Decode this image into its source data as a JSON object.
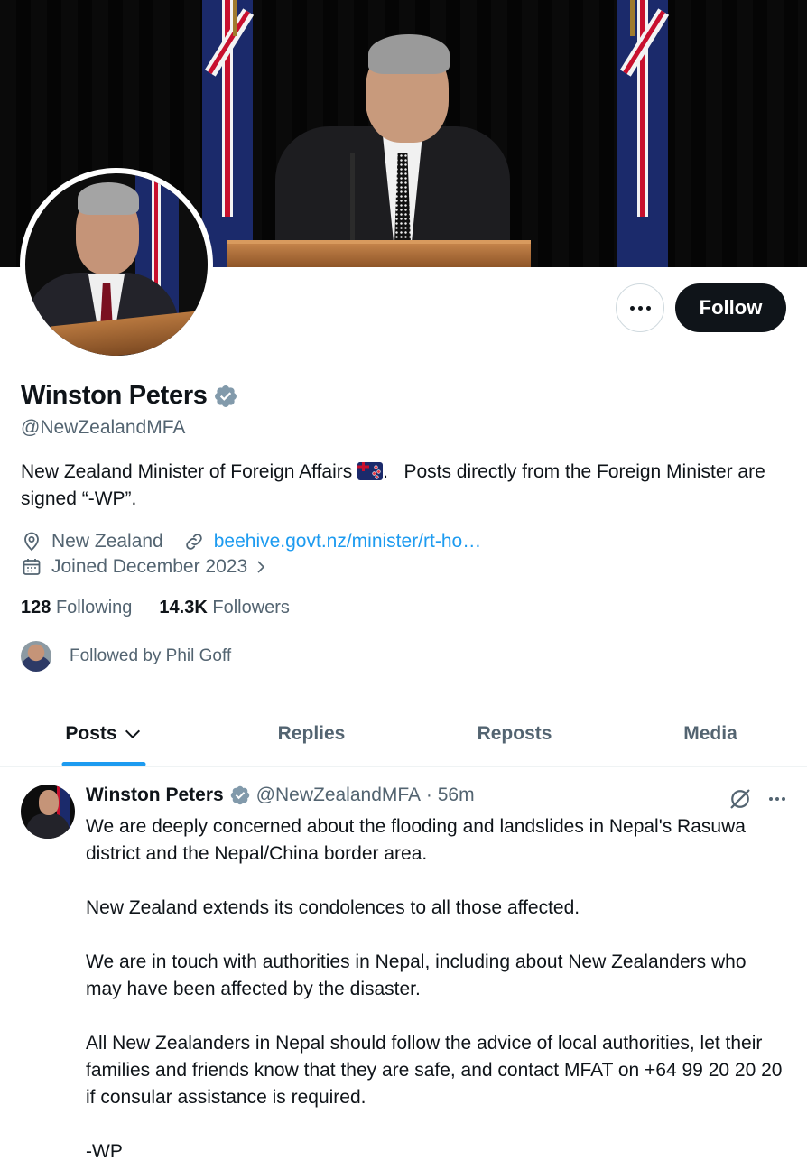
{
  "profile": {
    "name": "Winston Peters",
    "handle": "@NewZealandMFA",
    "bio_part1": "New Zealand Minister of Foreign Affairs ",
    "bio_flag": "nz-flag-emoji",
    "bio_part2": ".   Posts directly from the Foreign Minister are signed “-WP”.",
    "location": "New Zealand",
    "website": "beehive.govt.nz/minister/rt-ho…",
    "joined": "Joined December 2023",
    "following_count": "128",
    "following_label": "Following",
    "followers_count": "14.3K",
    "followers_label": "Followers",
    "followed_by": "Followed by Phil Goff"
  },
  "actions": {
    "follow_label": "Follow",
    "more_icon": "more-horizontal-icon"
  },
  "tabs": [
    {
      "label": "Posts",
      "active": true
    },
    {
      "label": "Replies",
      "active": false
    },
    {
      "label": "Reposts",
      "active": false
    },
    {
      "label": "Media",
      "active": false
    }
  ],
  "tweet": {
    "author_name": "Winston Peters",
    "author_handle": "@NewZealandMFA",
    "separator": " · ",
    "time": "56m",
    "text": "We are deeply concerned about the flooding and landslides in Nepal's Rasuwa district and the Nepal/China border area.\n\nNew Zealand extends its condolences to all those affected.\n\nWe are in touch with authorities in Nepal, including about New Zealanders who may have been affected by the disaster.\n\nAll New Zealanders in Nepal should follow the advice of local authorities, let their families and friends know that they are safe, and contact MFAT on +64 99 20 20 20 if consular assistance is required.\n\n-WP"
  },
  "colors": {
    "accent": "#1d9bf0",
    "text_primary": "#0f1419",
    "text_secondary": "#536471",
    "verified_badge": "#829aab",
    "follow_bg": "#0f1419"
  }
}
